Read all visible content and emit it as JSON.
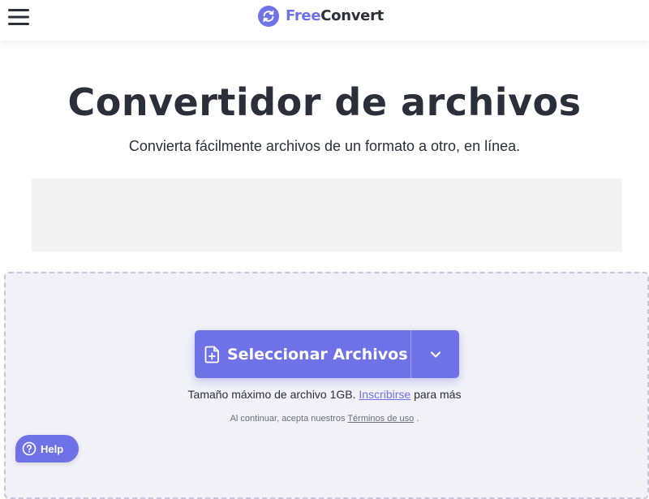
{
  "header": {
    "menu_icon": "hamburger-menu-icon",
    "logo_icon": "refresh-circle-icon",
    "brand_free": "Free",
    "brand_convert": "Convert"
  },
  "hero": {
    "title": "Convertidor de archivos",
    "subtitle": "Convierta fácilmente archivos de un formato a otro, en línea."
  },
  "upload": {
    "select_label": "Seleccionar Archivos",
    "select_icon": "file-plus-icon",
    "dropdown_icon": "chevron-down-icon",
    "size_note_prefix": "Tamaño máximo de archivo 1GB. ",
    "signup_link": "Inscribirse",
    "size_note_suffix": " para más",
    "terms_prefix": "Al continuar, acepta nuestros ",
    "terms_link": "Términos de uso",
    "terms_suffix": " ."
  },
  "help": {
    "label": "Help",
    "icon": "question-circle-icon"
  },
  "colors": {
    "accent": "#6f72e6",
    "text": "#2b2f3a",
    "dropzone_bg": "#f1f1f7",
    "ad_bg": "#f3f3f4"
  }
}
